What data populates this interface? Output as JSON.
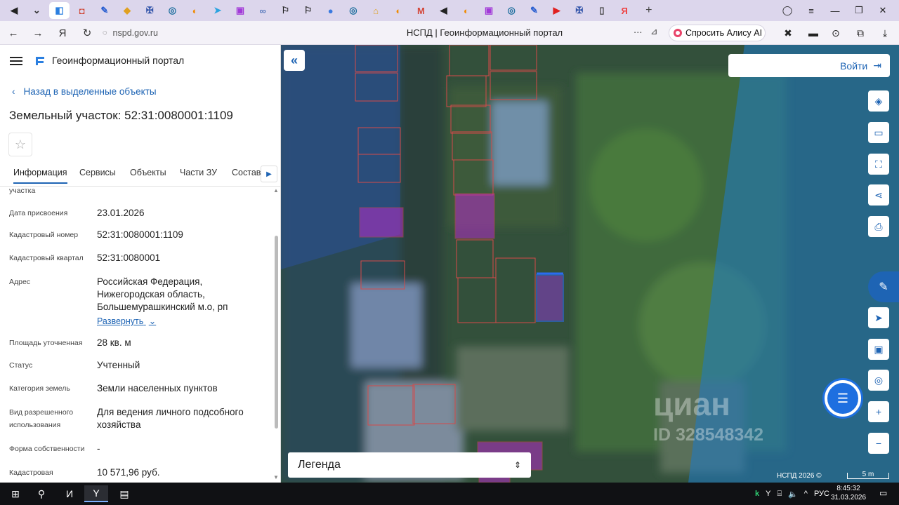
{
  "browser": {
    "tabs": [
      {
        "icon": "speaker-icon",
        "active": false
      },
      {
        "icon": "chevron-down-icon",
        "active": false
      },
      {
        "icon": "portal-tab-icon",
        "active": true
      },
      {
        "icon": "gift-icon",
        "active": false
      },
      {
        "icon": "feather-icon",
        "active": false
      },
      {
        "icon": "kite-icon",
        "active": false
      },
      {
        "icon": "emblem-icon",
        "active": false
      },
      {
        "icon": "target-icon",
        "active": false
      },
      {
        "icon": "shield-orange-icon",
        "active": false
      },
      {
        "icon": "telegram-icon",
        "active": false
      },
      {
        "icon": "wb-icon",
        "active": false
      },
      {
        "icon": "link-icon",
        "active": false
      },
      {
        "icon": "runner-icon",
        "active": false
      },
      {
        "icon": "runner-icon",
        "active": false
      },
      {
        "icon": "globe-icon",
        "active": false
      },
      {
        "icon": "target-icon",
        "active": false
      },
      {
        "icon": "house-icon",
        "active": false
      },
      {
        "icon": "shield-orange-icon",
        "active": false
      },
      {
        "icon": "gmail-icon",
        "active": false
      },
      {
        "icon": "mute-icon",
        "active": false
      },
      {
        "icon": "shield-orange-icon",
        "active": false
      },
      {
        "icon": "wb-icon",
        "active": false
      },
      {
        "icon": "target-icon",
        "active": false
      },
      {
        "icon": "feather-icon",
        "active": false
      },
      {
        "icon": "play-red-icon",
        "active": false
      },
      {
        "icon": "emblem-icon",
        "active": false
      },
      {
        "icon": "document-icon",
        "active": false
      },
      {
        "icon": "yandex-icon",
        "active": false
      }
    ],
    "new_tab": "+",
    "url": "nspd.gov.ru",
    "page_title": "НСПД | Геоинформационный портал",
    "alice_label": "Спросить Алису AI"
  },
  "panel": {
    "portal_name": "Геоинформационный портал",
    "back_label": "Назад в выделенные объекты",
    "object_title": "Земельный участок: 52:31:0080001:1109",
    "tabs": [
      "Информация",
      "Сервисы",
      "Объекты",
      "Части ЗУ",
      "Состав"
    ],
    "partial_label": "участка",
    "fields": [
      {
        "label": "Дата присвоения",
        "value": "23.01.2026"
      },
      {
        "label": "Кадастровый номер",
        "value": "52:31:0080001:1109"
      },
      {
        "label": "Кадастровый квартал",
        "value": "52:31:0080001"
      },
      {
        "label": "Адрес",
        "value": "Российская Федерация, Нижегородская область, Большемурашкинский м.о, рп"
      },
      {
        "label": "Площадь уточненная",
        "value": "28 кв. м"
      },
      {
        "label": "Статус",
        "value": "Учтенный"
      },
      {
        "label": "Категория земель",
        "value": "Земли населенных пунктов"
      },
      {
        "label": "Вид разрешенного использования",
        "value": "Для ведения личного подсобного хозяйства"
      },
      {
        "label": "Форма собственности",
        "value": "-"
      },
      {
        "label": "Кадастровая",
        "value": "10 571,96 руб."
      }
    ],
    "expand_label": "Развернуть"
  },
  "map": {
    "login_label": "Войти",
    "legend_label": "Легенда",
    "copyright": "НСПД 2026 ©",
    "scale_label": "5 m",
    "watermark": "циан",
    "watermark_id": "ID 328548342"
  },
  "taskbar": {
    "lang": "РУС",
    "time": "8:45:32",
    "date": "31.03.2026"
  },
  "colors": {
    "accent": "#1e64b4",
    "tabstrip": "#dcd6ec",
    "parcel_outline": "#d44a4a",
    "parcel_magenta": "#b42cc8",
    "selected_parcel": "#2a6cf0",
    "cadastral_zone": "#3b7fd6"
  }
}
